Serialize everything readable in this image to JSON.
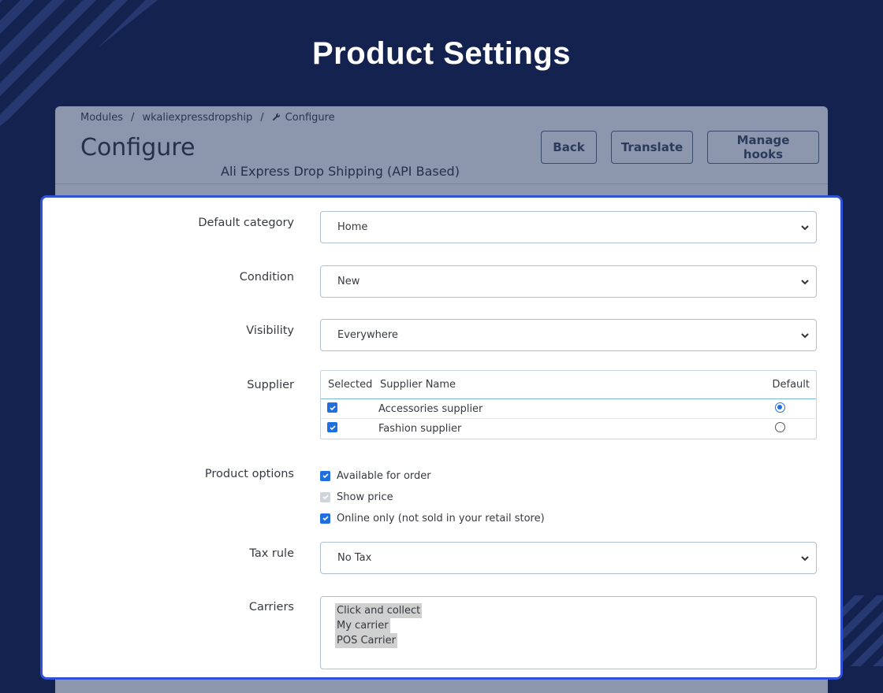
{
  "page_title": "Product Settings",
  "breadcrumb": {
    "items": [
      "Modules",
      "wkaliexpressdropship",
      "Configure"
    ],
    "separator": "/"
  },
  "header": {
    "title": "Configure",
    "module_name": "Ali Express Drop Shipping (API Based)",
    "buttons": {
      "back": "Back",
      "translate": "Translate",
      "manage_hooks": "Manage hooks"
    }
  },
  "form": {
    "default_category": {
      "label": "Default category",
      "value": "Home"
    },
    "condition": {
      "label": "Condition",
      "value": "New"
    },
    "visibility": {
      "label": "Visibility",
      "value": "Everywhere"
    },
    "supplier": {
      "label": "Supplier",
      "columns": [
        "Selected",
        "Supplier Name",
        "Default"
      ],
      "rows": [
        {
          "name": "Accessories supplier",
          "selected": true,
          "default": true
        },
        {
          "name": "Fashion supplier",
          "selected": true,
          "default": false
        }
      ]
    },
    "product_options": {
      "label": "Product options",
      "options": [
        {
          "label": "Available for order",
          "checked": true,
          "disabled": false
        },
        {
          "label": "Show price",
          "checked": true,
          "disabled": true
        },
        {
          "label": "Online only (not sold in your retail store)",
          "checked": true,
          "disabled": false
        }
      ]
    },
    "tax_rule": {
      "label": "Tax rule",
      "value": "No Tax"
    },
    "carriers": {
      "label": "Carriers",
      "options": [
        "Click and collect",
        "My carrier",
        "POS Carrier"
      ]
    }
  },
  "colors": {
    "background": "#13224f",
    "card_border": "#2f52d6",
    "checkbox": "#1f6fe0"
  }
}
